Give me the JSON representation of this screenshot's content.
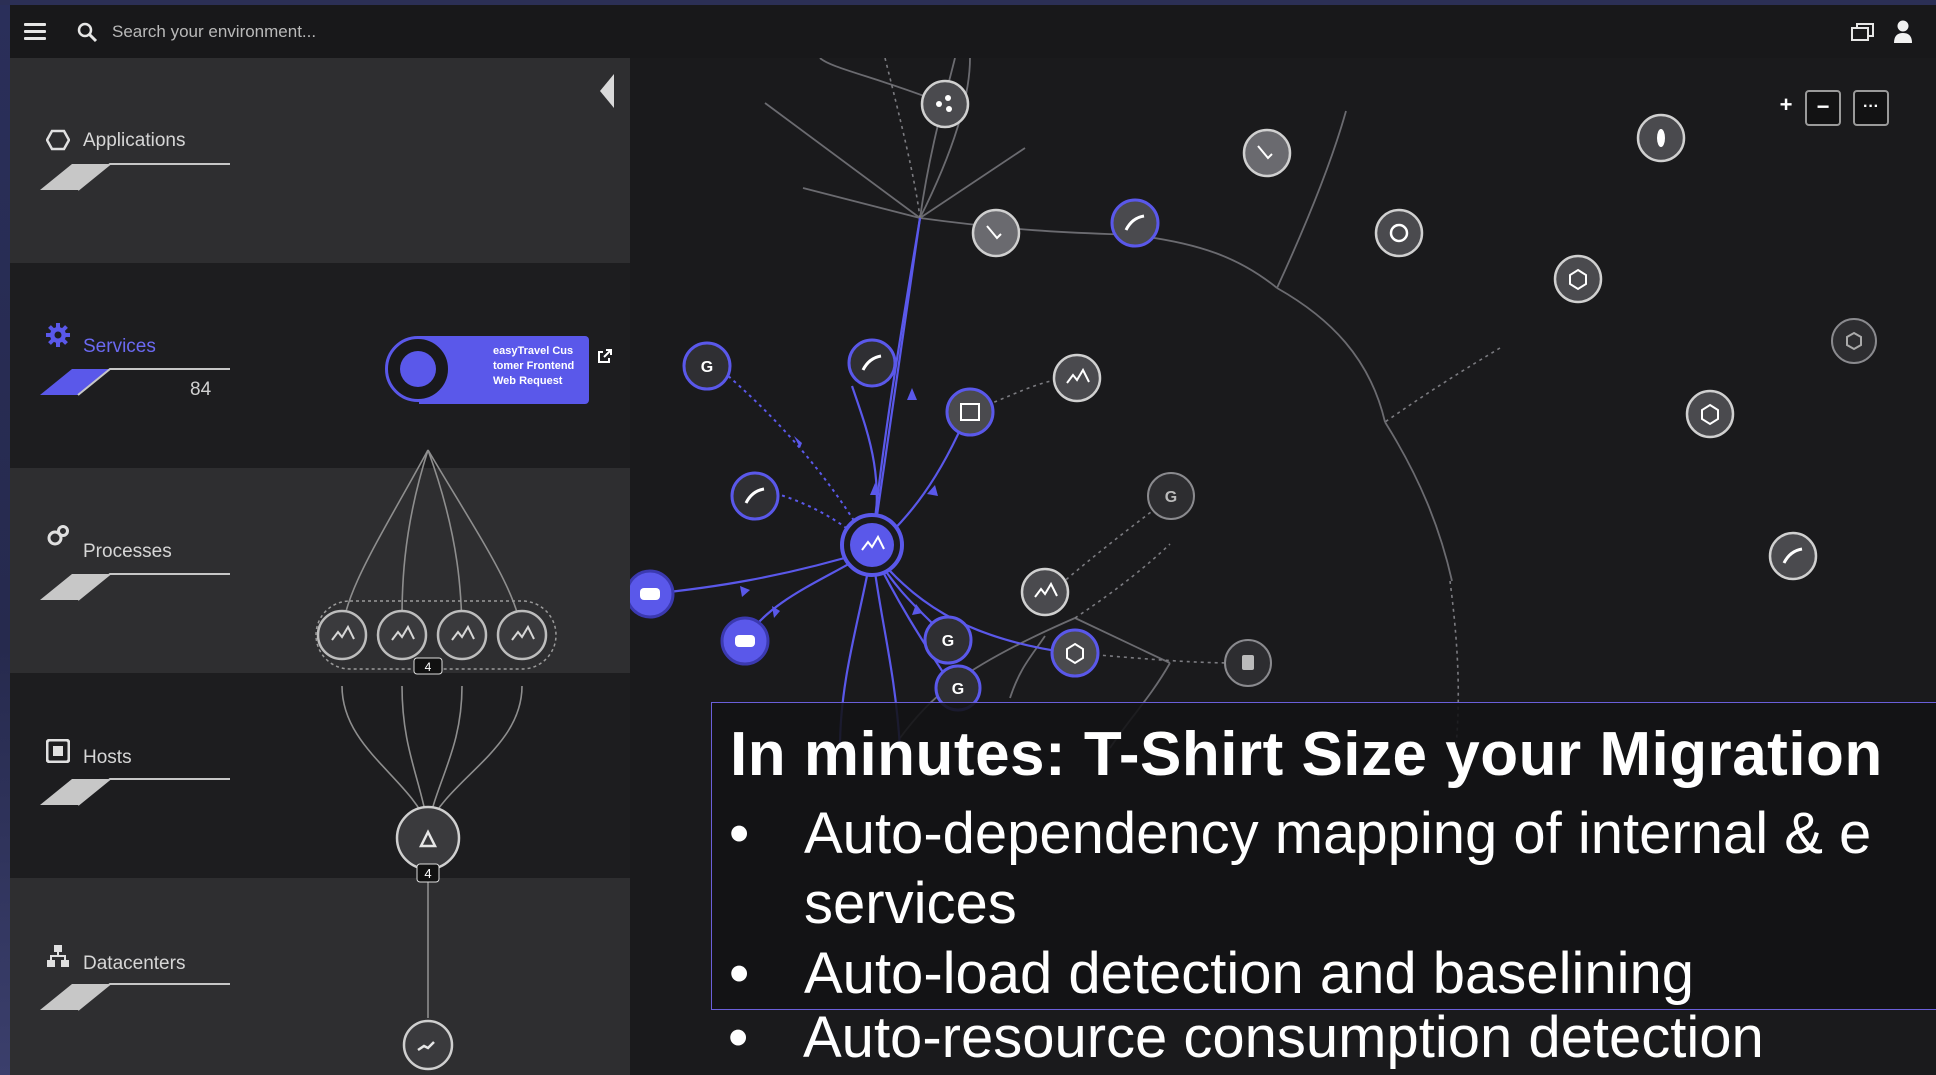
{
  "topbar": {
    "search_placeholder": "Search your environment..."
  },
  "sidebar": {
    "layers": [
      {
        "label": "Applications",
        "count": ""
      },
      {
        "label": "Services",
        "count": "84"
      },
      {
        "label": "Processes",
        "count": ""
      },
      {
        "label": "Hosts",
        "count": ""
      },
      {
        "label": "Datacenters",
        "count": ""
      }
    ],
    "service_card": "easyTravel Customer Frontend Web Request",
    "service_card_lines": [
      "easyTravel Cus",
      "tomer Frontend",
      "Web Request"
    ],
    "process_group_badge": "4",
    "host_badge": "4"
  },
  "zoom": {
    "plus": "+",
    "minus": "−",
    "more": "···"
  },
  "overlay": {
    "title": "In minutes: T-Shirt Size your Migration",
    "bullets": [
      "Auto-dependency mapping of internal & e",
      "services",
      "Auto-load detection and baselining",
      "Auto-resource consumption detection"
    ]
  },
  "colors": {
    "accent": "#5a58ea",
    "node": "#7f7f85",
    "background": "#1a1a1c"
  }
}
